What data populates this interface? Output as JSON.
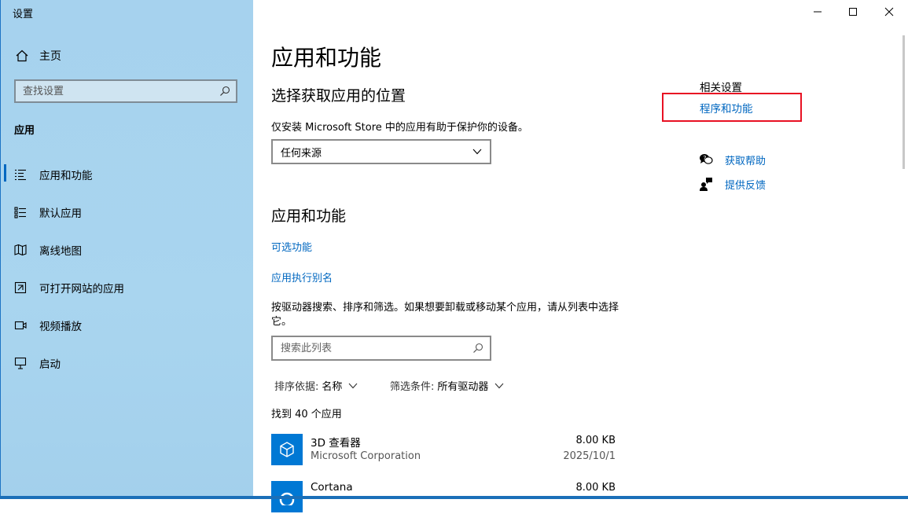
{
  "window": {
    "title": "设置"
  },
  "sidebar": {
    "home_label": "主页",
    "search_placeholder": "查找设置",
    "section_label": "应用",
    "items": [
      {
        "label": "应用和功能",
        "icon": "apps-features-icon",
        "active": true
      },
      {
        "label": "默认应用",
        "icon": "default-apps-icon"
      },
      {
        "label": "离线地图",
        "icon": "offline-maps-icon"
      },
      {
        "label": "可打开网站的应用",
        "icon": "apps-for-websites-icon"
      },
      {
        "label": "视频播放",
        "icon": "video-playback-icon"
      },
      {
        "label": "启动",
        "icon": "startup-icon"
      }
    ]
  },
  "main": {
    "title": "应用和功能",
    "install_section": {
      "heading": "选择获取应用的位置",
      "description": "仅安装 Microsoft Store 中的应用有助于保护你的设备。",
      "source_selected": "任何来源"
    },
    "apps_section": {
      "heading": "应用和功能",
      "optional_features_link": "可选功能",
      "app_alias_link": "应用执行别名",
      "search_description": "按驱动器搜索、排序和筛选。如果想要卸载或移动某个应用，请从列表中选择它。",
      "search_placeholder": "搜索此列表",
      "sort_label": "排序依据:",
      "sort_value": "名称",
      "filter_label": "筛选条件:",
      "filter_value": "所有驱动器",
      "count_text": "找到 40 个应用",
      "apps": [
        {
          "name": "3D 查看器",
          "publisher": "Microsoft Corporation",
          "size": "8.00 KB",
          "date": "2025/10/1"
        },
        {
          "name": "Cortana",
          "publisher": "",
          "size": "8.00 KB",
          "date": ""
        }
      ]
    }
  },
  "related": {
    "heading": "相关设置",
    "programs_link": "程序和功能",
    "help_link": "获取帮助",
    "feedback_link": "提供反馈"
  },
  "colors": {
    "accent": "#0067c0",
    "sidebar_bg": "#a8d4ef",
    "highlight_border": "#e81123",
    "app_tile": "#0078d4"
  }
}
